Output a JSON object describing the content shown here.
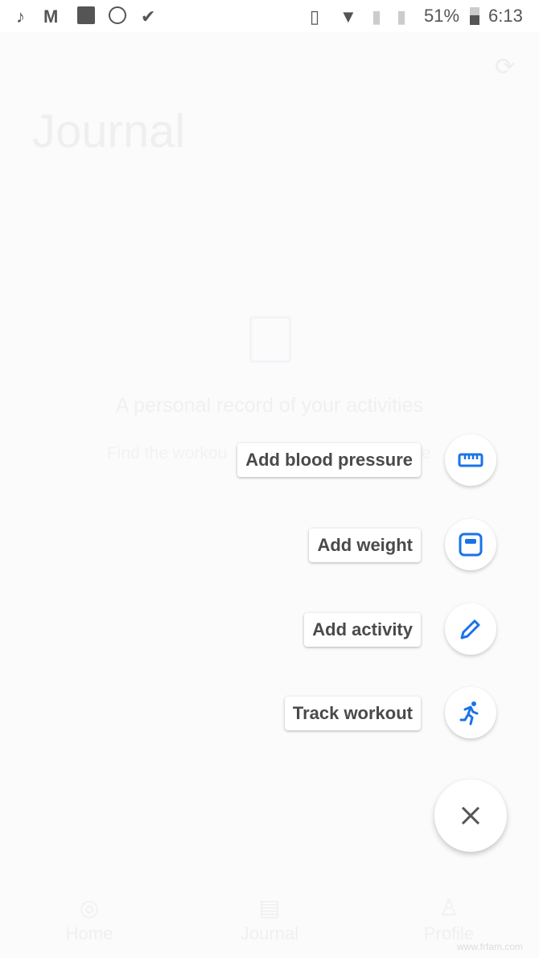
{
  "status_bar": {
    "icons_left": [
      "tiktok-icon",
      "m-app-icon",
      "image-icon",
      "navigation-icon",
      "checkmark-app-icon"
    ],
    "icons_right": [
      "vibrate-icon",
      "wifi-icon",
      "no-sim-icon",
      "no-sim-icon"
    ],
    "battery": "51%",
    "time": "6:13"
  },
  "page": {
    "title": "Journal",
    "empty_heading": "A personal record of your activities",
    "empty_sub_left": "Find the workou",
    "empty_sub_right": "e"
  },
  "fab_menu": {
    "items": [
      {
        "label": "Add blood pressure",
        "icon": "blood-pressure-icon"
      },
      {
        "label": "Add weight",
        "icon": "scale-icon"
      },
      {
        "label": "Add activity",
        "icon": "pencil-icon"
      },
      {
        "label": "Track workout",
        "icon": "running-icon"
      }
    ],
    "accent": "#1a73e8",
    "close_icon": "close-icon"
  },
  "bottom_nav": [
    {
      "label": "Home"
    },
    {
      "label": "Journal"
    },
    {
      "label": "Profile"
    }
  ],
  "watermark": "www.frfam.com"
}
